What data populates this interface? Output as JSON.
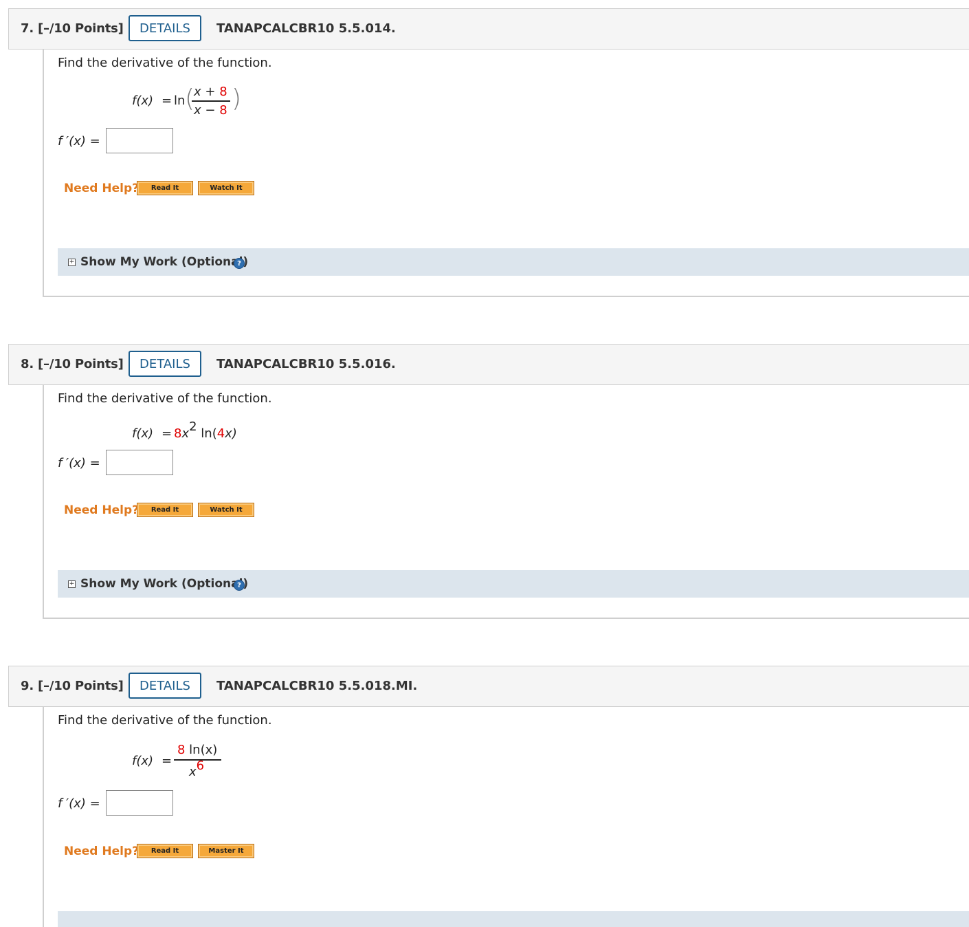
{
  "questions": [
    {
      "number": "7. [–/10 Points]",
      "details": "DETAILS",
      "code": "TANAPCALCBR10 5.5.014.",
      "prompt": "Find the derivative of the function.",
      "fx": "f(x)",
      "eq": "=",
      "ln": "ln",
      "num_var": "x + ",
      "num_const": "8",
      "den_var": "x − ",
      "den_const": "8",
      "answer_label": "f ′(x)  =",
      "need_help": "Need Help?",
      "btn1": "Read It",
      "btn2": "Watch It",
      "show_work": "Show My Work (Optional)"
    },
    {
      "number": "8. [–/10 Points]",
      "details": "DETAILS",
      "code": "TANAPCALCBR10 5.5.016.",
      "prompt": "Find the derivative of the function.",
      "fx": "f(x)",
      "eq": "=",
      "coef": "8",
      "xvar": "x",
      "exp": "2",
      "ln_open": " ln(",
      "arg_coef": "4",
      "arg_close": "x)",
      "answer_label": "f ′(x)  =",
      "need_help": "Need Help?",
      "btn1": "Read It",
      "btn2": "Watch It",
      "show_work": "Show My Work (Optional)"
    },
    {
      "number": "9. [–/10 Points]",
      "details": "DETAILS",
      "code": "TANAPCALCBR10 5.5.018.MI.",
      "prompt": "Find the derivative of the function.",
      "fx": "f(x)",
      "eq": "=",
      "num_coef": "8",
      "num_rest": " ln(x)",
      "den_var": "x",
      "den_exp": "6",
      "answer_label": "f ′(x)  =",
      "need_help": "Need Help?",
      "btn1": "Read It",
      "btn2": "Master It"
    }
  ],
  "icons": {
    "expand": "plus-box-icon",
    "help": "question-circle-icon"
  },
  "colors": {
    "details_border": "#1f5f8e",
    "need_help": "#e07a1f",
    "button": "#f5a83a",
    "work_bar": "#dce5ed",
    "highlight": "#e00000"
  }
}
